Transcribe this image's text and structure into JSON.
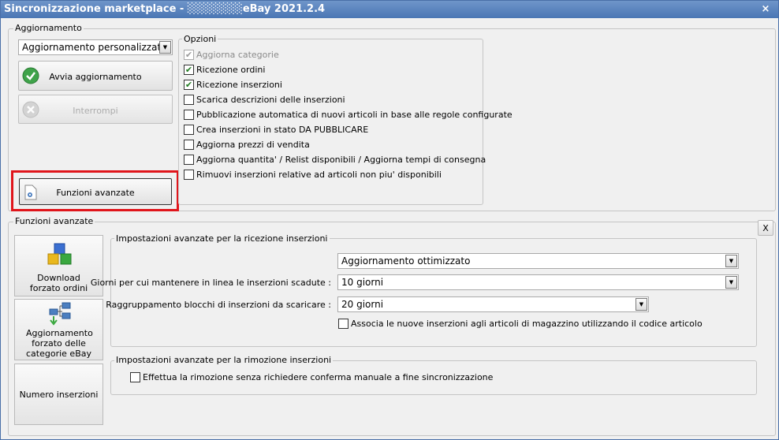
{
  "window": {
    "title": "Sincronizzazione marketplace - ░░░░░░░eBay 2021.2.4",
    "close_glyph": "×"
  },
  "aggiornamento": {
    "group_label": "Aggiornamento",
    "mode_select": "Aggiornamento personalizzato",
    "start_button": "Avvia aggiornamento",
    "stop_button": "Interrompi",
    "advanced_button": "Funzioni avanzate"
  },
  "opzioni": {
    "group_label": "Opzioni",
    "items": [
      {
        "label": "Aggiorna categorie",
        "checked": true,
        "disabled": true
      },
      {
        "label": "Ricezione ordini",
        "checked": true,
        "disabled": false
      },
      {
        "label": "Ricezione inserzioni",
        "checked": true,
        "disabled": false
      },
      {
        "label": "Scarica descrizioni delle inserzioni",
        "checked": false,
        "disabled": false
      },
      {
        "label": "Pubblicazione automatica di nuovi articoli in base alle regole configurate",
        "checked": false,
        "disabled": false
      },
      {
        "label": "Crea inserzioni in stato DA PUBBLICARE",
        "checked": false,
        "disabled": false
      },
      {
        "label": "Aggiorna prezzi di vendita",
        "checked": false,
        "disabled": false
      },
      {
        "label": "Aggiorna quantita' / Relist disponibili / Aggiorna tempi di consegna",
        "checked": false,
        "disabled": false
      },
      {
        "label": "Rimuovi inserzioni relative ad articoli non piu' disponibili",
        "checked": false,
        "disabled": false
      }
    ]
  },
  "funzioni_avanzate": {
    "group_label": "Funzioni avanzate",
    "close_label": "X",
    "side_buttons": {
      "download_orders": "Download forzato ordini",
      "update_categories": "Aggiornamento forzato delle categorie eBay",
      "listings_count": "Numero inserzioni"
    },
    "ricezione": {
      "group_label": "Impostazioni avanzate per la ricezione inserzioni",
      "update_mode": "Aggiornamento ottimizzato",
      "days_label": "Giorni per cui mantenere in linea le inserzioni scadute :",
      "days_value": "10 giorni",
      "blocks_label": "Raggruppamento blocchi di inserzioni da scaricare :",
      "blocks_value": "20 giorni",
      "associate_label": "Associa le nuove inserzioni agli articoli di magazzino utilizzando il codice articolo",
      "associate_checked": false
    },
    "rimozione": {
      "group_label": "Impostazioni avanzate per la rimozione inserzioni",
      "confirm_label": "Effettua la rimozione senza richiedere conferma manuale a fine sincronizzazione",
      "confirm_checked": false
    }
  },
  "icons": {
    "check": "check-circle-icon",
    "stop": "stop-circle-icon",
    "settings": "settings-document-icon",
    "cubes": "cubes-icon",
    "tree": "category-tree-icon"
  },
  "colors": {
    "highlight": "#e0151b",
    "title_bar": "#5a82bc"
  }
}
